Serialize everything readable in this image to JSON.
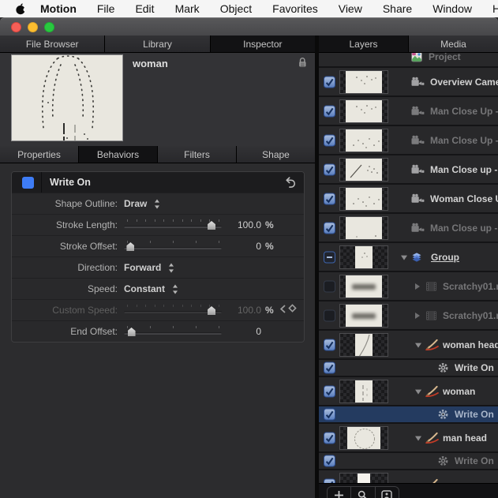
{
  "menubar": {
    "app": "Motion",
    "items": [
      "File",
      "Edit",
      "Mark",
      "Object",
      "Favorites",
      "View",
      "Share",
      "Window",
      "Help"
    ]
  },
  "colors": {
    "accent_blue": "#3e7cf5",
    "selected_row": "#243b60",
    "thumb_cream": "#e9e7df"
  },
  "left_panel": {
    "tabs": [
      {
        "label": "File Browser",
        "selected": false
      },
      {
        "label": "Library",
        "selected": false
      },
      {
        "label": "Inspector",
        "selected": true
      }
    ],
    "preview": {
      "title": "woman",
      "lock_icon": "lock-icon"
    },
    "subtabs": [
      {
        "label": "Properties",
        "selected": false
      },
      {
        "label": "Behaviors",
        "selected": true
      },
      {
        "label": "Filters",
        "selected": false
      },
      {
        "label": "Shape",
        "selected": false
      }
    ],
    "behavior": {
      "title": "Write On",
      "rows": [
        {
          "type": "popup",
          "label": "Shape Outline:",
          "value": "Draw"
        },
        {
          "type": "slider",
          "label": "Stroke Length:",
          "value": "100.0",
          "suffix": "%",
          "ticks": 11,
          "pos": 93,
          "disabled": false,
          "keyframe_nav": false
        },
        {
          "type": "slider",
          "label": "Stroke Offset:",
          "value": "0",
          "suffix": "%",
          "ticks": 5,
          "pos": 3,
          "disabled": false,
          "keyframe_nav": false
        },
        {
          "type": "popup",
          "label": "Direction:",
          "value": "Forward"
        },
        {
          "type": "popup",
          "label": "Speed:",
          "value": "Constant"
        },
        {
          "type": "slider",
          "label": "Custom Speed:",
          "value": "100.0",
          "suffix": "%",
          "ticks": 11,
          "pos": 93,
          "disabled": true,
          "keyframe_nav": true
        },
        {
          "type": "slider",
          "label": "End Offset:",
          "value": "0",
          "suffix": "",
          "ticks": 5,
          "pos": 4,
          "disabled": false,
          "keyframe_nav": false
        }
      ]
    }
  },
  "layers_panel": {
    "tabs": [
      {
        "label": "Layers",
        "selected": true
      },
      {
        "label": "Media",
        "selected": false
      }
    ],
    "rows": [
      {
        "kind": "project",
        "name": "Project",
        "check": "none",
        "dim": true,
        "partial_top": true
      },
      {
        "kind": "camera",
        "name": "Overview Came",
        "check": "on",
        "dim": false,
        "thumb": "wide"
      },
      {
        "kind": "camera",
        "name": "Man Close Up -",
        "check": "on",
        "dim": true,
        "thumb": "wide"
      },
      {
        "kind": "camera",
        "name": "Man Close Up -",
        "check": "on",
        "dim": true,
        "thumb": "wide2"
      },
      {
        "kind": "camera",
        "name": "Man Close up -",
        "check": "on",
        "dim": false,
        "thumb": "wideline"
      },
      {
        "kind": "camera",
        "name": "Woman Close U",
        "check": "on",
        "dim": false,
        "thumb": "wide2"
      },
      {
        "kind": "camera",
        "name": "Man Close up -",
        "check": "on",
        "dim": true,
        "thumb": "wideplain"
      },
      {
        "kind": "group",
        "name": "Group",
        "check": "mixed",
        "dim": false,
        "thumb": "portrait",
        "disclosure": "open",
        "underline": true
      },
      {
        "kind": "media",
        "name": "Scratchy01.m",
        "check": "off",
        "dim": true,
        "thumb": "blur",
        "disclosure": "closed"
      },
      {
        "kind": "media",
        "name": "Scratchy01.m",
        "check": "off",
        "dim": true,
        "thumb": "blur",
        "disclosure": "closed"
      },
      {
        "kind": "shape",
        "name": "woman head",
        "check": "on",
        "dim": false,
        "thumb": "curve",
        "disclosure": "open"
      },
      {
        "kind": "behavior",
        "name": "Write On",
        "check": "on",
        "dim": false
      },
      {
        "kind": "shape",
        "name": "woman",
        "check": "on",
        "dim": false,
        "thumb": "dashes",
        "disclosure": "open"
      },
      {
        "kind": "behavior",
        "name": "Write On",
        "check": "on",
        "dim": false,
        "selected": true
      },
      {
        "kind": "shape",
        "name": "man head",
        "check": "on",
        "dim": false,
        "thumb": "circle",
        "disclosure": "open"
      },
      {
        "kind": "behavior",
        "name": "Write On",
        "check": "on",
        "dim": true
      },
      {
        "kind": "shape",
        "name": "",
        "check": "on",
        "dim": false,
        "thumb": "smallsquare",
        "partial": true
      }
    ],
    "toolbar": [
      {
        "icon": "plus-icon",
        "label": "+"
      },
      {
        "icon": "search-icon",
        "label": ""
      },
      {
        "icon": "insert-object-icon",
        "label": ""
      }
    ]
  }
}
